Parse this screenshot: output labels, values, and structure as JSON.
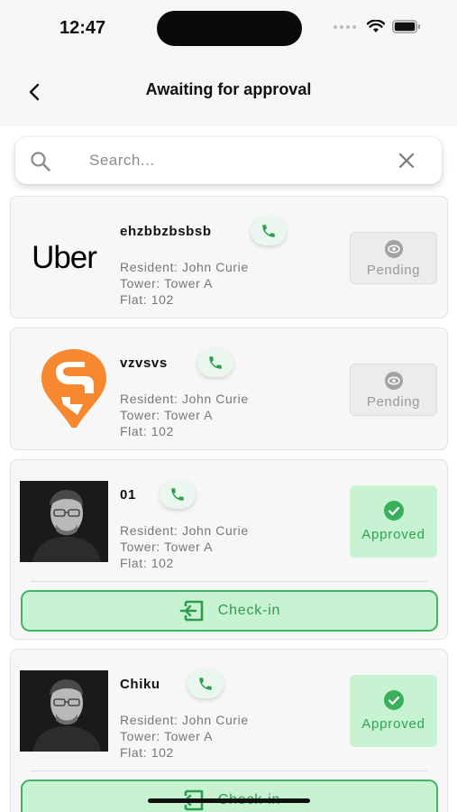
{
  "status_bar": {
    "time": "12:47"
  },
  "header": {
    "title": "Awaiting for approval"
  },
  "search": {
    "placeholder": "Search...",
    "value": ""
  },
  "cards": [
    {
      "logo": "uber-logo",
      "logo_text": "Uber",
      "name": "ehzbbzbsbsb",
      "resident": "Resident: John Curie",
      "tower": "Tower: Tower A",
      "flat": "Flat: 102",
      "status": "Pending"
    },
    {
      "logo": "swiggy-logo",
      "name": "vzvsvs",
      "resident": "Resident: John Curie",
      "tower": "Tower: Tower A",
      "flat": "Flat: 102",
      "status": "Pending"
    },
    {
      "logo": "person-photo",
      "name": "01",
      "resident": "Resident: John Curie",
      "tower": "Tower: Tower A",
      "flat": "Flat: 102",
      "status": "Approved",
      "checkin_label": "Check-in"
    },
    {
      "logo": "person-photo",
      "name": "Chiku",
      "resident": "Resident: John Curie",
      "tower": "Tower: Tower A",
      "flat": "Flat: 102",
      "status": "Approved",
      "checkin_label": "Check-in"
    }
  ],
  "colors": {
    "approved_bg": "#c8f3d3",
    "approved_text": "#29a64e",
    "pending_bg": "#ececec",
    "call_icon": "#2e9e4f",
    "swiggy_orange": "#f7882f"
  }
}
